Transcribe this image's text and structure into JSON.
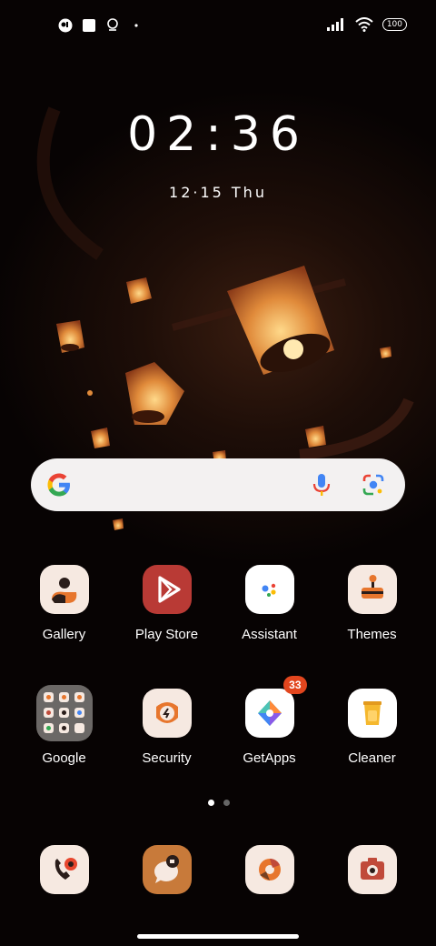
{
  "status": {
    "left_icons": [
      "app-notification-icon",
      "square-notification-icon",
      "location-icon",
      "dot-icon"
    ],
    "battery": "100"
  },
  "clock": "02:36",
  "date": "12·15  Thu",
  "search_bar": {
    "left_icon": "google-g-icon",
    "right_icons": [
      "microphone-icon",
      "lens-camera-icon"
    ]
  },
  "apps": [
    {
      "label": "Gallery",
      "icon": "gallery-icon"
    },
    {
      "label": "Play Store",
      "icon": "play-store-icon"
    },
    {
      "label": "Assistant",
      "icon": "assistant-icon"
    },
    {
      "label": "Themes",
      "icon": "themes-icon"
    },
    {
      "label": "Google",
      "icon": "google-folder-icon"
    },
    {
      "label": "Security",
      "icon": "security-icon"
    },
    {
      "label": "GetApps",
      "icon": "getapps-icon",
      "badge": "33"
    },
    {
      "label": "Cleaner",
      "icon": "cleaner-icon"
    }
  ],
  "page_indicator": {
    "pages": 2,
    "active": 1
  },
  "dock": [
    {
      "icon": "phone-icon"
    },
    {
      "icon": "messaging-icon"
    },
    {
      "icon": "browser-icon"
    },
    {
      "icon": "camera-icon"
    }
  ],
  "colors": {
    "accent_orange": "#c87a3a",
    "badge": "#e2461e",
    "play_red": "#b93a35"
  }
}
